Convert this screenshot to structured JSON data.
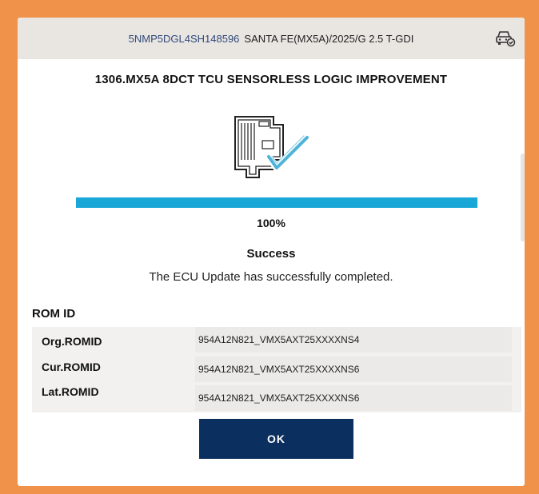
{
  "vehicle": {
    "vin": "5NMP5DGL4SH148596",
    "model": "SANTA FE(MX5A)/2025/G 2.5 T-GDI",
    "icon": "car-check-icon"
  },
  "update": {
    "title": "1306.MX5A 8DCT TCU SENSORLESS LOGIC IMPROVEMENT",
    "progress_value": 100,
    "progress_text": "100%",
    "status": "Success",
    "message": "The ECU Update has successfully completed."
  },
  "rom": {
    "heading": "ROM ID",
    "rows": [
      {
        "label": "Org.ROMID",
        "value": "954A12N821_VMX5AXT25XXXXNS4"
      },
      {
        "label": "Cur.ROMID",
        "value": "954A12N821_VMX5AXT25XXXXNS6"
      },
      {
        "label": "Lat.ROMID",
        "value": "954A12N821_VMX5AXT25XXXXNS6"
      }
    ]
  },
  "actions": {
    "ok_label": "OK"
  },
  "colors": {
    "frame": "#f0924a",
    "progress": "#18a7d6",
    "button": "#0b2f5e",
    "check": "#4fb4d8"
  }
}
